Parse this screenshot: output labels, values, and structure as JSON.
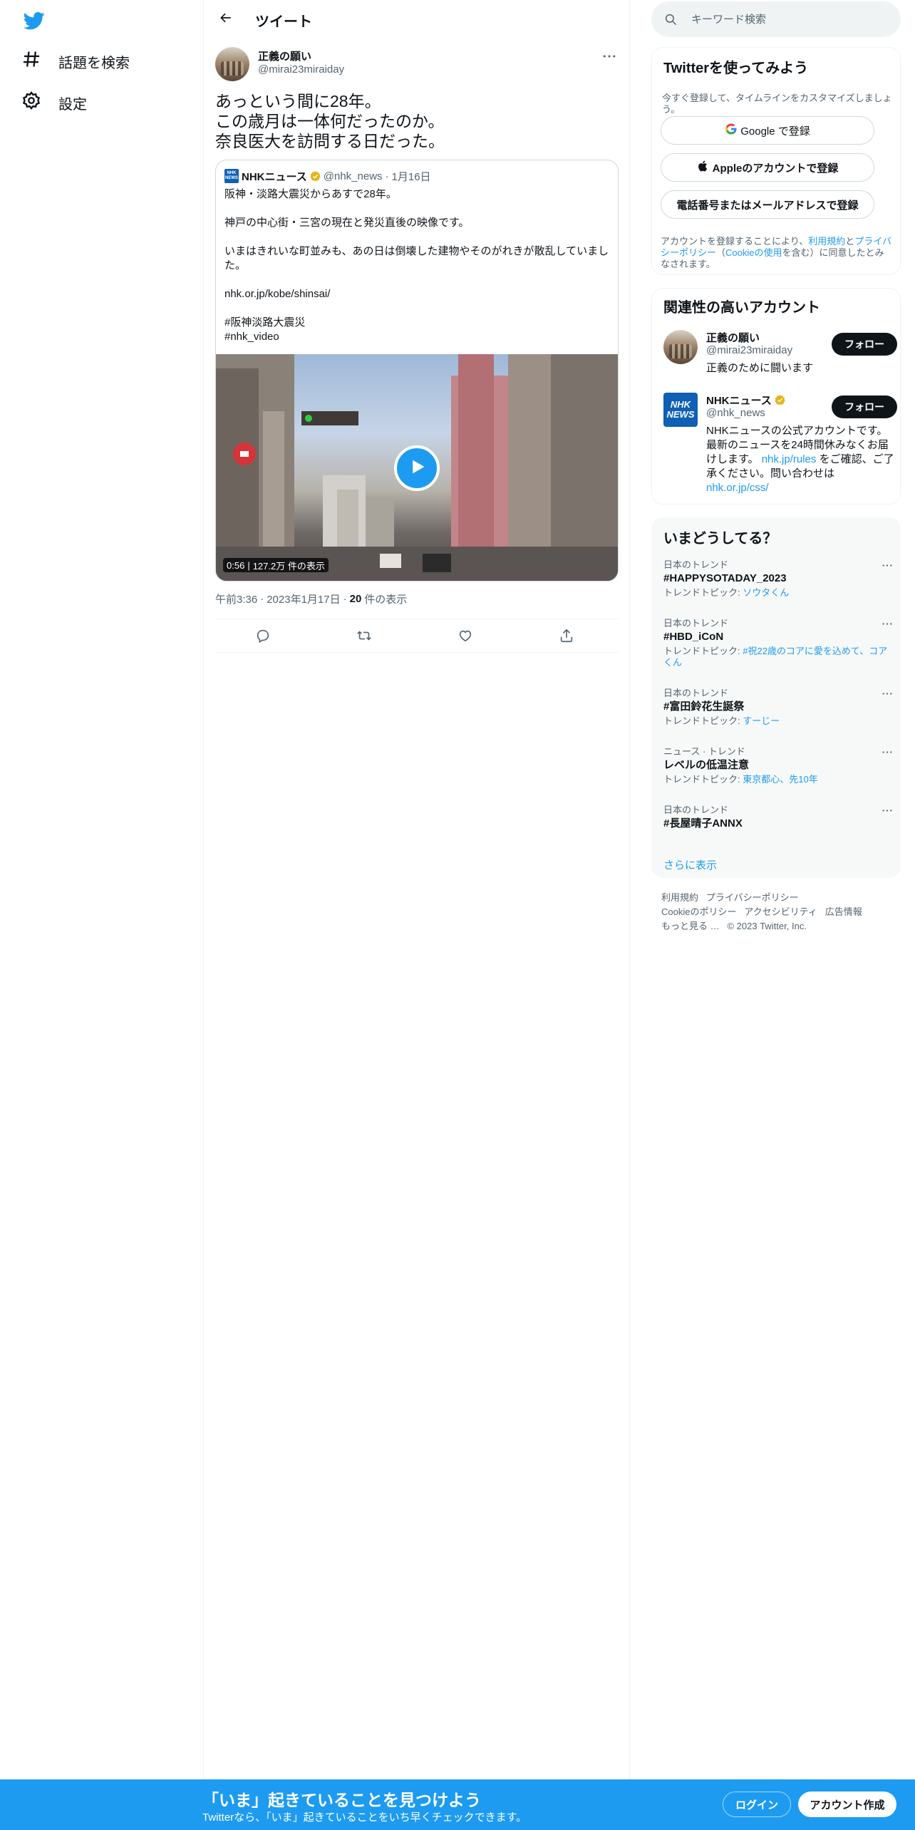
{
  "colors": {
    "accent": "#1d9bf0",
    "text": "#0f1419",
    "muted": "#536471",
    "nhk_blue": "#0f5fb4",
    "verified_gold": "#e2b719"
  },
  "nav": {
    "logo_icon": "twitter-bird-icon",
    "items": [
      {
        "label": "話題を検索",
        "icon": "hashtag-icon"
      },
      {
        "label": "設定",
        "icon": "gear-icon"
      }
    ]
  },
  "header": {
    "title": "ツイート",
    "back_icon": "arrow-left-icon"
  },
  "tweet": {
    "author_name": "正義の願い",
    "author_handle": "@mirai23miraiday",
    "lines": [
      "あっという間に28年。",
      "この歳月は一体何だったのか。",
      "奈良医大を訪問する日だった。"
    ],
    "quote": {
      "author_name": "NHKニュース",
      "author_handle": "@nhk_news",
      "date": "1月16日",
      "paragraphs": [
        "阪神・淡路大震災からあすで28年。",
        "神戸の中心街・三宮の現在と発災直後の映像です。",
        "いまはきれいな町並みも、あの日は倒壊した建物やそのがれきが散乱していました。",
        "nhk.or.jp/kobe/shinsai/",
        "#阪神淡路大震災\n#nhk_video"
      ],
      "video": {
        "duration": "0:56",
        "views": "127.2万 件の表示"
      }
    },
    "time": "午前3:36",
    "date": "2023年1月17日",
    "view_count": "20",
    "view_label": "件の表示",
    "actions": [
      "reply-icon",
      "retweet-icon",
      "like-icon",
      "share-icon"
    ]
  },
  "search": {
    "placeholder": "キーワード検索"
  },
  "signup": {
    "title": "Twitterを使ってみよう",
    "subtitle": "今すぐ登録して、タイムラインをカスタマイズしましょう。",
    "google": "Google で登録",
    "apple": "Appleのアカウントで登録",
    "phone": "電話番号またはメールアドレスで登録",
    "legal_prefix": "アカウントを登録することにより、",
    "legal_terms": "利用規約",
    "legal_and": "と",
    "legal_privacy": "プライバシーポリシー",
    "legal_open": "（",
    "legal_cookie": "Cookieの使用",
    "legal_suffix": "を含む）に同意したとみなされます。"
  },
  "relevant": {
    "title": "関連性の高いアカウント",
    "accounts": [
      {
        "name": "正義の願い",
        "handle": "@mirai23miraiday",
        "bio": "正義のために闘います",
        "follow": "フォロー"
      },
      {
        "name": "NHKニュース",
        "handle": "@nhk_news",
        "bio_pre": "NHKニュースの公式アカウントです。最新のニュースを24時間休みなくお届けします。",
        "bio_link1": "nhk.jp/rules",
        "bio_mid": " をご確認、ご了承ください。問い合わせは",
        "bio_link2": "nhk.or.jp/css/",
        "follow": "フォロー",
        "avatar_text": "NHK NEWS"
      }
    ]
  },
  "trends": {
    "title": "いまどうしてる？",
    "items": [
      {
        "context": "日本のトレンド",
        "name": "#HAPPYSOTADAY_2023",
        "topic_label": "トレンドトピック: ",
        "topic": "ソウタくん"
      },
      {
        "context": "日本のトレンド",
        "name": "#HBD_iCoN",
        "topic_label": "トレンドトピック: ",
        "topic": "#祝22歳のコアに愛を込めて、コアくん"
      },
      {
        "context": "日本のトレンド",
        "name": "#富田鈴花生誕祭",
        "topic_label": "トレンドトピック: ",
        "topic": "すーじー"
      },
      {
        "context": "ニュース · トレンド",
        "name": "レベルの低温注意",
        "topic_label": "トレンドトピック: ",
        "topic": "東京都心、先10年"
      },
      {
        "context": "日本のトレンド",
        "name": "#長屋晴子ANNX",
        "topic_label": "",
        "topic": ""
      }
    ],
    "show_more": "さらに表示"
  },
  "footer": {
    "links": [
      "利用規約",
      "プライバシーポリシー",
      "Cookieのポリシー",
      "アクセシビリティ",
      "広告情報",
      "もっと見る …"
    ],
    "copyright": "© 2023 Twitter, Inc."
  },
  "bottom_bar": {
    "title": "「いま」起きていることを見つけよう",
    "subtitle": "Twitterなら、「いま」起きていることをいち早くチェックできます。",
    "login": "ログイン",
    "signup": "アカウント作成"
  }
}
